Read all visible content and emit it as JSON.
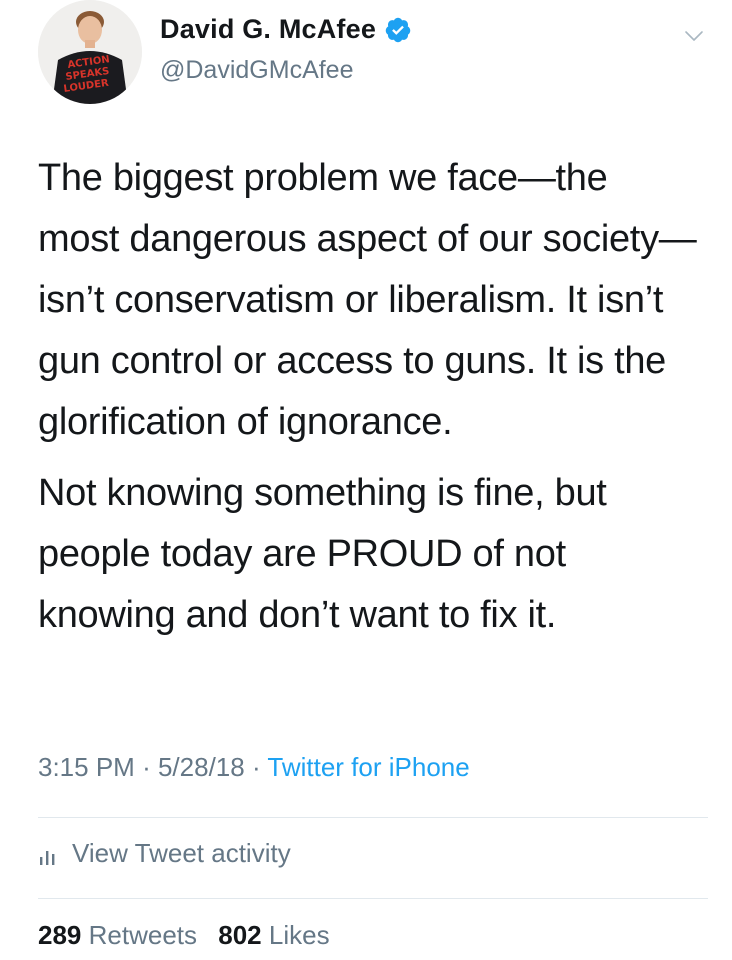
{
  "author": {
    "display_name": "David G. McAfee",
    "handle": "@DavidGMcAfee",
    "verified": true,
    "avatar": "avatar-photo",
    "avatar_shirt_text": "ACTION SPEAKS LOUDER"
  },
  "icons": {
    "verified": "verified-badge-icon",
    "menu": "chevron-down-icon",
    "activity": "bar-chart-icon"
  },
  "tweet": {
    "paragraphs": [
      "The biggest problem we face—the most dangerous aspect of our society—isn’t conservatism or liberalism. It isn’t gun control or access to guns. It is the glorification of ignorance.",
      "Not knowing something is fine, but people today are PROUD of not knowing and don’t want to fix it."
    ]
  },
  "meta": {
    "time": "3:15 PM",
    "separator": "·",
    "date": "5/28/18",
    "source": "Twitter for iPhone"
  },
  "activity": {
    "label": "View Tweet activity"
  },
  "stats": {
    "retweets_count": "289",
    "retweets_label": "Retweets",
    "likes_count": "802",
    "likes_label": "Likes"
  },
  "colors": {
    "text": "#14171a",
    "secondary": "#657786",
    "accent": "#1da1f2",
    "divider": "#e1e8ed"
  }
}
